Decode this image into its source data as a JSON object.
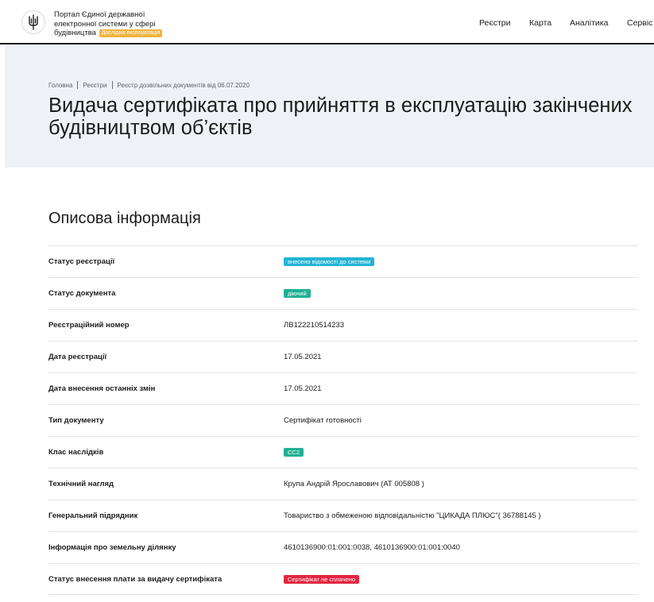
{
  "header": {
    "portal_title": "Портал Єдиної державної електронної системи у сфері будівництва",
    "beta_badge": "Дослідна експлуатація",
    "nav": [
      "Реєстри",
      "Карта",
      "Аналітика",
      "Сервіс"
    ]
  },
  "breadcrumb": {
    "items": [
      "Головна",
      "Реєстри",
      "Реєстр дозвільних документів від 06.07.2020"
    ]
  },
  "page_title": "Видача сертифіката про прийняття в експлуатацію закінчених будівництвом об’єктів",
  "section_title": "Описова інформація",
  "colors": {
    "tag_cyan": "#22b4d4",
    "tag_green": "#1fb195",
    "tag_red": "#e1263f",
    "beta": "#f0b43f",
    "hero_bg": "#eef2f7"
  },
  "rows": [
    {
      "label": "Статус реєстрації",
      "value": "внесено відомості до системи"
    },
    {
      "label": "Статус документа",
      "value": "діючий"
    },
    {
      "label": "Реєстраційний номер",
      "value": "ЛВ122210514233"
    },
    {
      "label": "Дата реєстрації",
      "value": "17.05.2021"
    },
    {
      "label": "Дата внесення останніх змін",
      "value": "17.05.2021"
    },
    {
      "label": "Тип документу",
      "value": "Сертифікат готовності"
    },
    {
      "label": "Клас наслідків",
      "value": "СС2"
    },
    {
      "label": "Технічний нагляд",
      "value": "Крупа Андрій Ярославович (АТ 005808 )"
    },
    {
      "label": "Генеральний підрядник",
      "value": "Товариство з обмеженою відповідальністю \"ЦИКАДА ПЛЮС\"( 36788145 )"
    },
    {
      "label": "Інформація про земельну ділянку",
      "value": "4610136900:01:001:0038, 4610136900:01:001:0040"
    },
    {
      "label": "Статус внесення плати за видачу сертифіката",
      "value": "Сертифікат не сплачено"
    }
  ]
}
